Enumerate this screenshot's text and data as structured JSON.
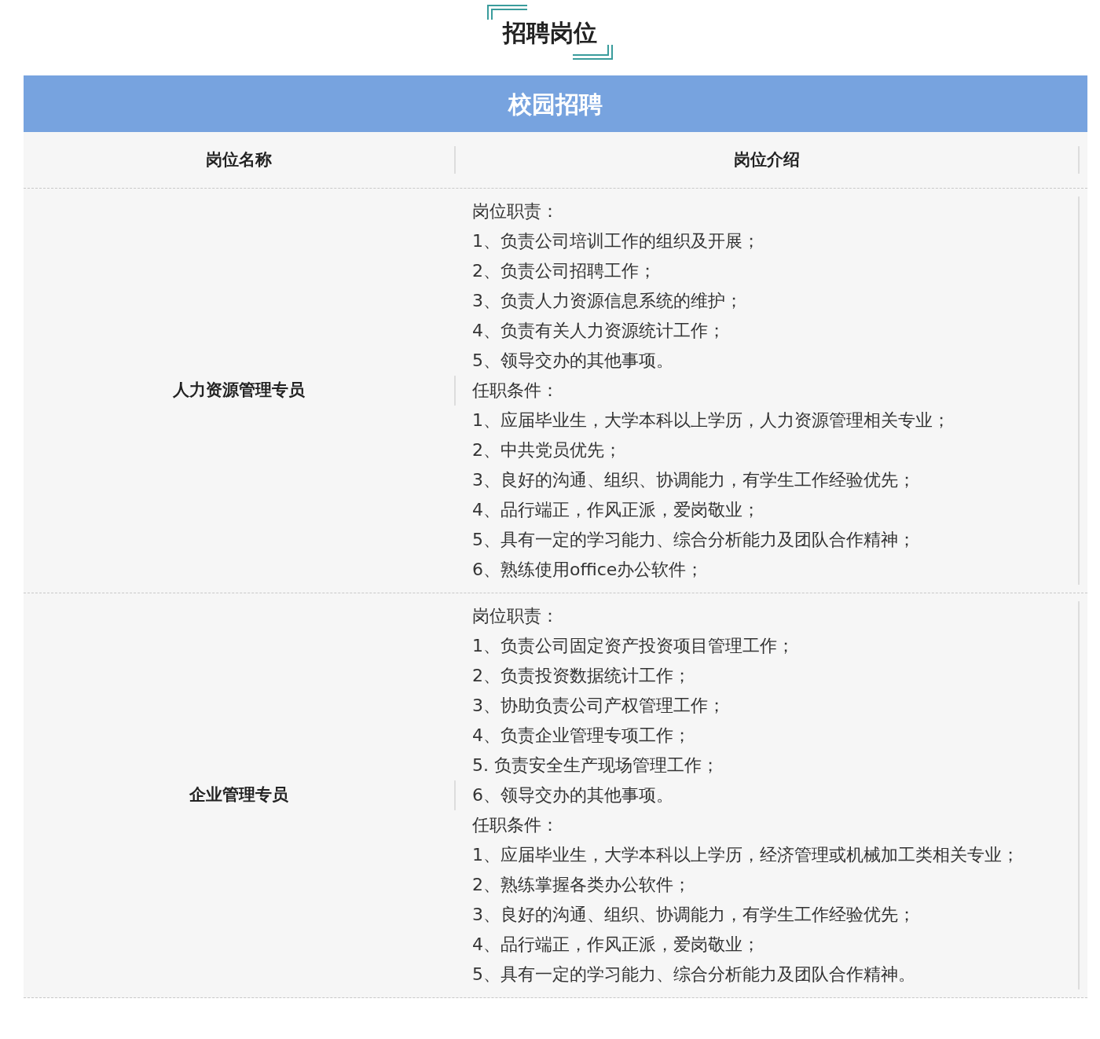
{
  "title": "招聘岗位",
  "banner": "校园招聘",
  "columns": [
    "岗位名称",
    "岗位介绍"
  ],
  "rows": [
    {
      "name": "人力资源管理专员",
      "lines": [
        "岗位职责：",
        "1、负责公司培训工作的组织及开展；",
        "2、负责公司招聘工作；",
        "3、负责人力资源信息系统的维护；",
        "4、负责有关人力资源统计工作；",
        "5、领导交办的其他事项。",
        "任职条件：",
        "1、应届毕业生，大学本科以上学历，人力资源管理相关专业；",
        "2、中共党员优先；",
        "3、良好的沟通、组织、协调能力，有学生工作经验优先；",
        "4、品行端正，作风正派，爱岗敬业；",
        "5、具有一定的学习能力、综合分析能力及团队合作精神；",
        "6、熟练使用office办公软件；"
      ]
    },
    {
      "name": "企业管理专员",
      "lines": [
        "岗位职责：",
        "1、负责公司固定资产投资项目管理工作；",
        "2、负责投资数据统计工作；",
        "3、协助负责公司产权管理工作；",
        "4、负责企业管理专项工作；",
        "5. 负责安全生产现场管理工作；",
        "6、领导交办的其他事项。",
        "任职条件：",
        "1、应届毕业生，大学本科以上学历，经济管理或机械加工类相关专业；",
        "2、熟练掌握各类办公软件；",
        "3、良好的沟通、组织、协调能力，有学生工作经验优先；",
        "4、品行端正，作风正派，爱岗敬业；",
        "5、具有一定的学习能力、综合分析能力及团队合作精神。"
      ]
    }
  ]
}
